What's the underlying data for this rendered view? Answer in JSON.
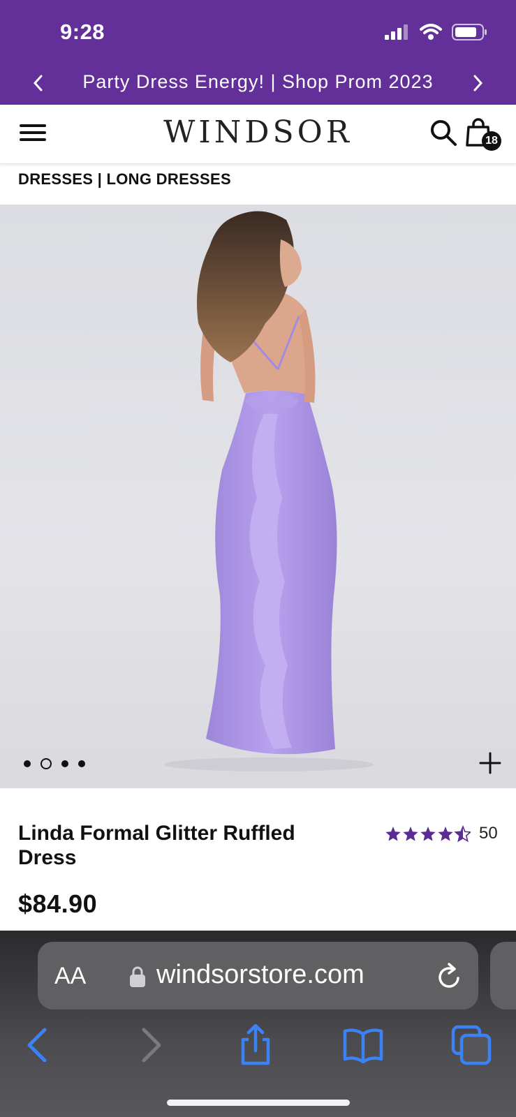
{
  "status_bar": {
    "time": "9:28"
  },
  "promo": {
    "text": "Party Dress Energy! | Shop Prom 2023"
  },
  "header": {
    "logo": "WINDSOR",
    "cart_count": "18"
  },
  "breadcrumb": "DRESSES | LONG DRESSES",
  "gallery": {
    "image_count": 4,
    "active_index": 1
  },
  "product": {
    "name": "Linda Formal Glitter Ruffled Dress",
    "price": "$84.90",
    "rating": 4.5,
    "review_count": "50"
  },
  "browser": {
    "text_size_label": "AA",
    "url": "windsorstore.com"
  },
  "colors": {
    "brand_purple": "#63309a",
    "dress_lavender": "#ab93e6",
    "safari_blue": "#3b82f6"
  }
}
